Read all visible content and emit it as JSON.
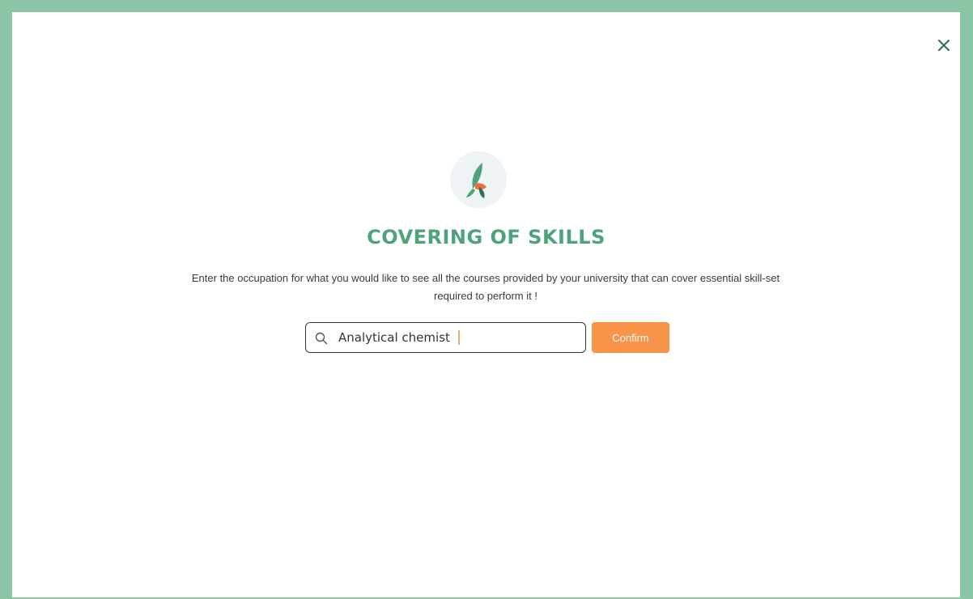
{
  "modal": {
    "title": "COVERING OF SKILLS",
    "description": "Enter the occupation for what you would like to see all the courses provided by your university that can cover essential skill-set required to perform it !",
    "close_icon": "close-icon",
    "logo_icon": "leaf-logo-icon"
  },
  "search": {
    "icon": "search-icon",
    "value": "Analytical chemist",
    "placeholder": ""
  },
  "confirm": {
    "label": "Confirm"
  },
  "colors": {
    "frame": "#8cc4a6",
    "title": "#4fa37a",
    "accent": "#f7944a",
    "logo_bg": "#eef3f6",
    "logo_green": "#4fa37a",
    "logo_dark": "#2f6f52"
  }
}
